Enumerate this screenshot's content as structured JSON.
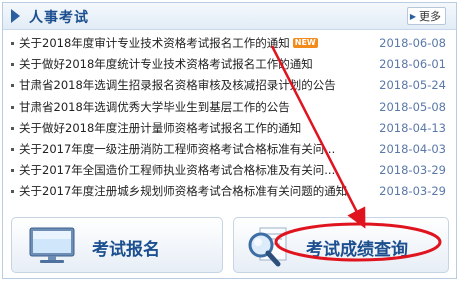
{
  "header": {
    "title": "人事考试",
    "more_label": "更多"
  },
  "news": [
    {
      "title": "关于2018年度审计专业技术资格考试报名工作的通知",
      "date": "2018-06-08",
      "badge": "NEW"
    },
    {
      "title": "关于做好2018年度统计专业技术资格考试报名工作的通知",
      "date": "2018-06-01"
    },
    {
      "title": "甘肃省2018年选调生招录报名资格审核及核减招录计划的公告",
      "date": "2018-05-24"
    },
    {
      "title": "甘肃省2018年选调优秀大学毕业生到基层工作的公告",
      "date": "2018-05-08"
    },
    {
      "title": "关于做好2018年度注册计量师资格考试报名工作的通知",
      "date": "2018-04-13"
    },
    {
      "title": "关于2017年度一级注册消防工程师资格考试合格标准有关问...",
      "date": "2018-04-03"
    },
    {
      "title": "关于2017年全国造价工程师执业资格考试合格标准及有关问...",
      "date": "2018-03-29"
    },
    {
      "title": "关于2017年度注册城乡规划师资格考试合格标准有关问题的通知",
      "date": "2018-03-29"
    }
  ],
  "buttons": {
    "register_label": "考试报名",
    "score_label": "考试成绩查询"
  },
  "icons": {
    "register": "monitor-icon",
    "score": "magnifier-icon"
  },
  "colors": {
    "title_blue": "#1c4f8f",
    "date_blue": "#5a78a8",
    "annotation_red": "#e0141e",
    "badge_orange": "#f28a1c"
  }
}
